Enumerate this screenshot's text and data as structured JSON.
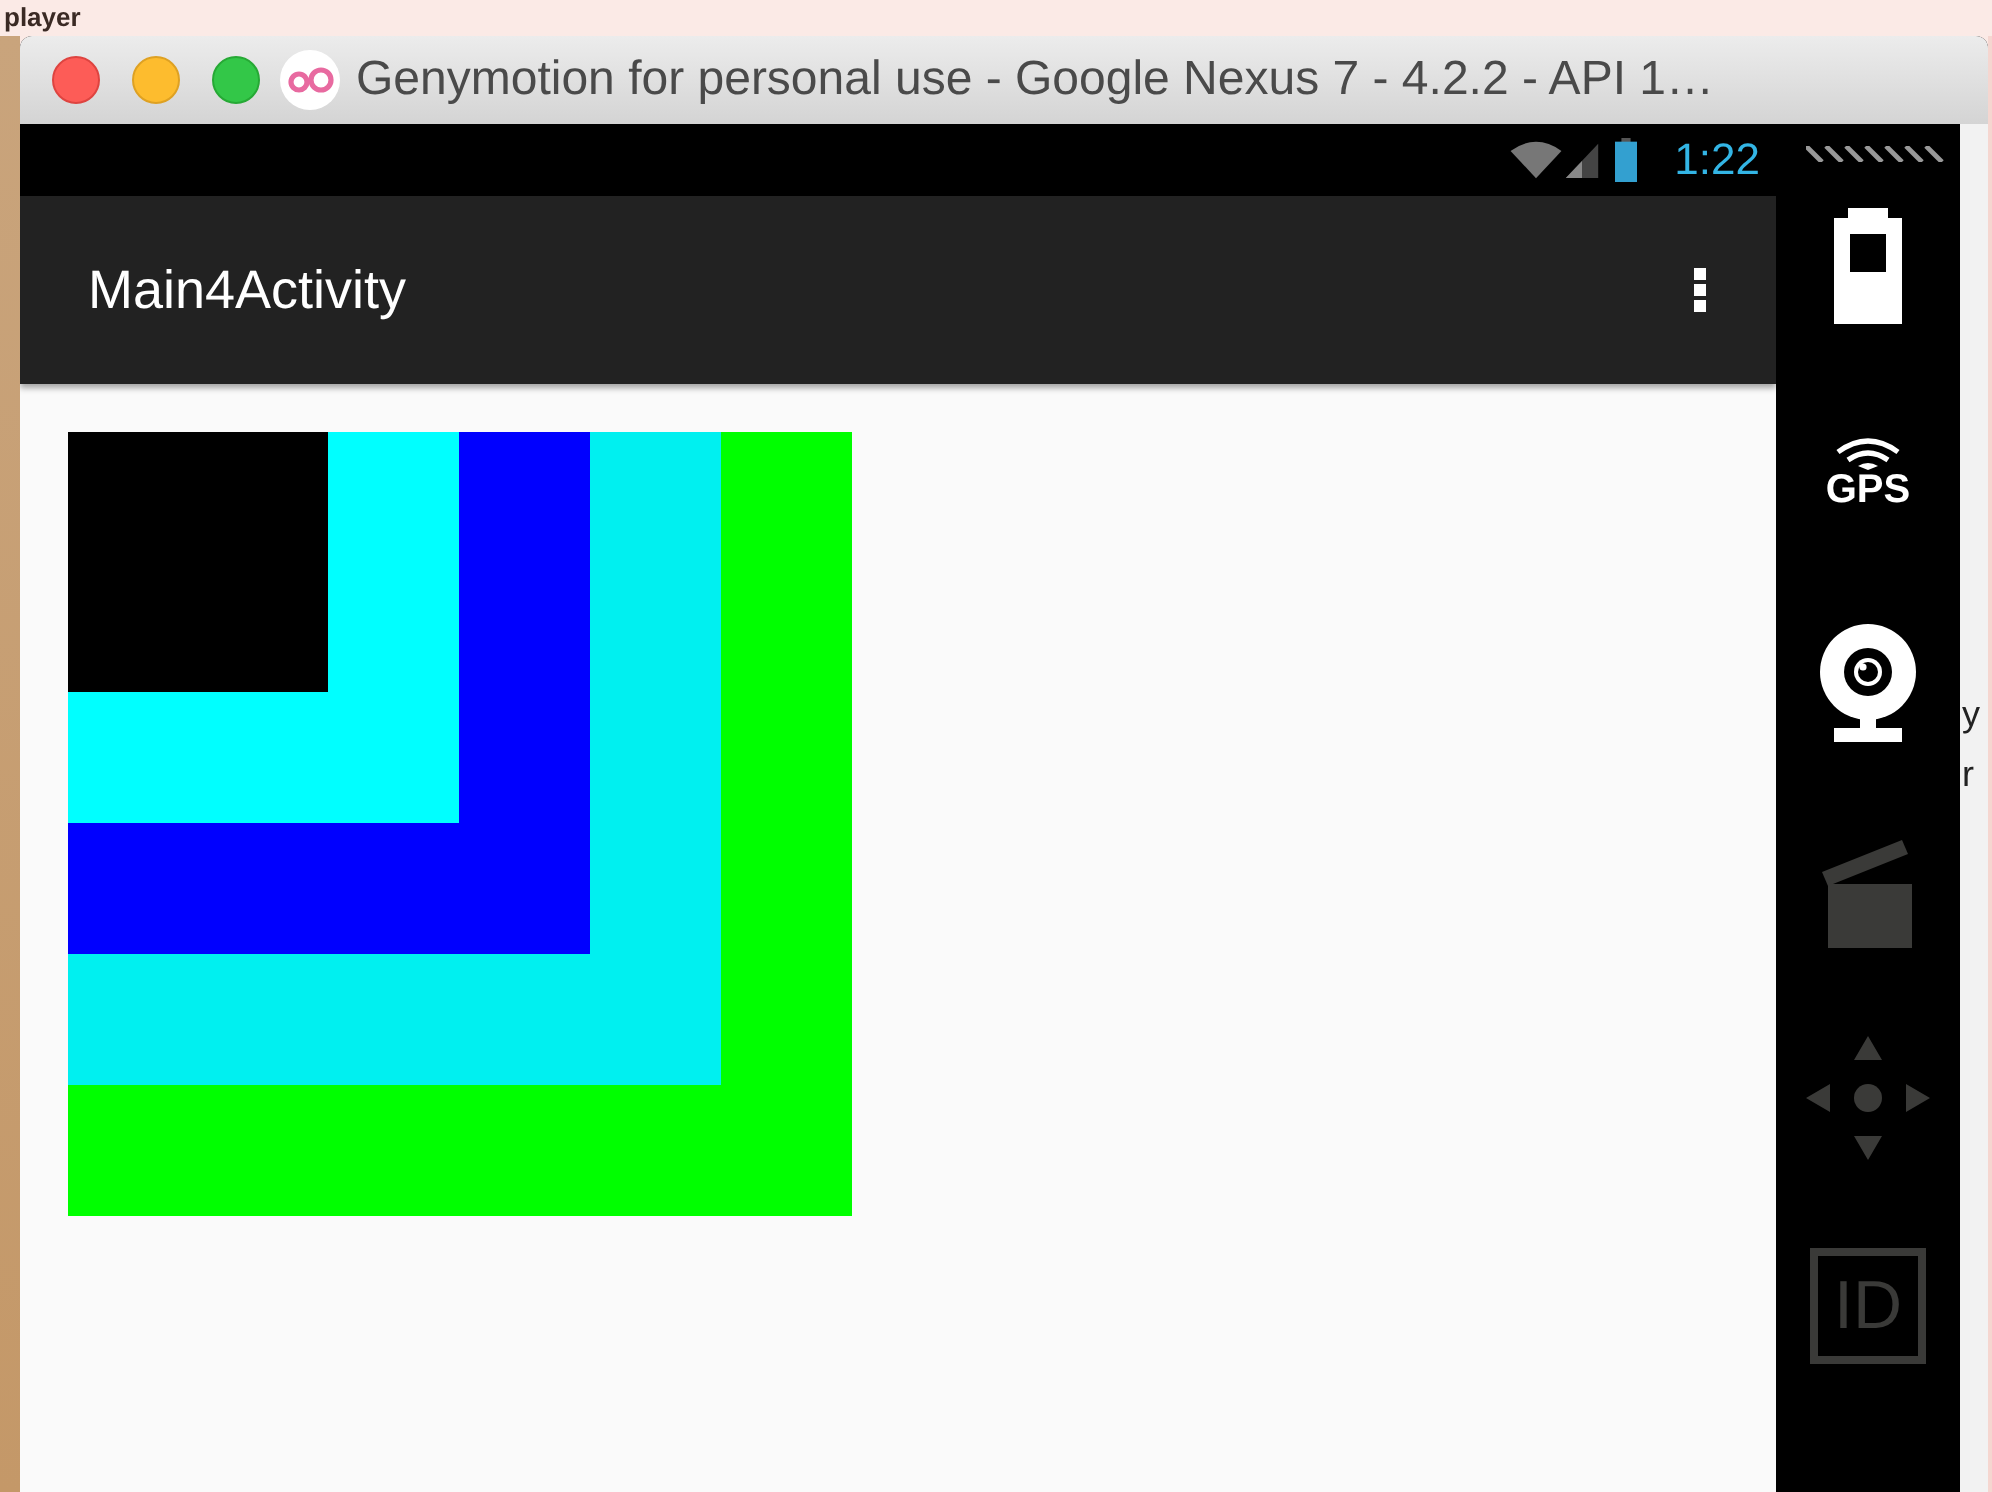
{
  "top_strip": {
    "text": "player"
  },
  "window": {
    "title": "Genymotion for personal use - Google Nexus 7 - 4.2.2 - API 1…"
  },
  "status_bar": {
    "time": "1:22"
  },
  "action_bar": {
    "title": "Main4Activity"
  },
  "squares": [
    {
      "color": "#00ff00"
    },
    {
      "color": "#00f0f0"
    },
    {
      "color": "#0000ff"
    },
    {
      "color": "#00ffff"
    },
    {
      "color": "#000000"
    }
  ],
  "toolbar": [
    {
      "kind": "battery",
      "disabled": false
    },
    {
      "kind": "gps",
      "label": "GPS",
      "disabled": false
    },
    {
      "kind": "camera",
      "disabled": false
    },
    {
      "kind": "capture",
      "disabled": true
    },
    {
      "kind": "dpad",
      "disabled": true
    },
    {
      "kind": "id",
      "label": "ID",
      "disabled": true
    }
  ],
  "background_text": [
    "y",
    "r"
  ]
}
